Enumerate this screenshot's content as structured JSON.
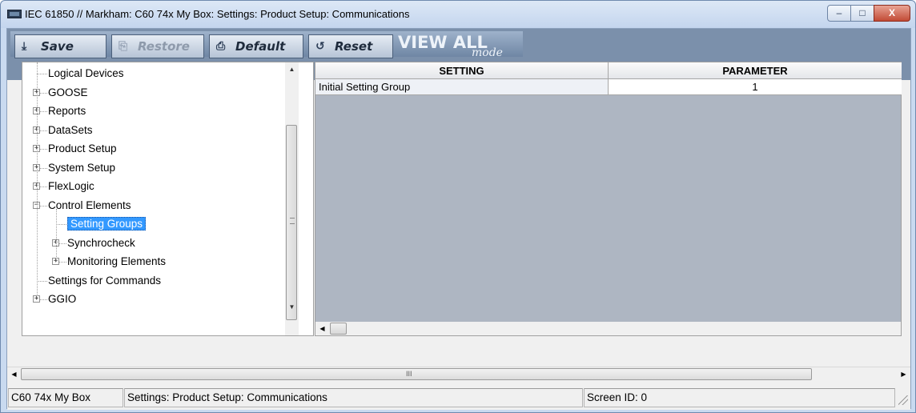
{
  "window": {
    "title": "IEC 61850 // Markham: C60 74x My Box: Settings: Product Setup: Communications",
    "controls": {
      "minimize": "–",
      "maximize": "□",
      "close": "X"
    }
  },
  "toolbar": {
    "save_label": "Save",
    "restore_label": "Restore",
    "default_label": "Default",
    "reset_label": "Reset",
    "viewall_label": "VIEW ALL",
    "viewall_mode": "mode",
    "icons": {
      "save": "save-icon",
      "restore": "restore-icon",
      "default": "default-icon",
      "reset": "reset-icon"
    }
  },
  "tree": {
    "items": [
      {
        "label": "Logical Devices",
        "expander": ""
      },
      {
        "label": "GOOSE",
        "expander": "+"
      },
      {
        "label": "Reports",
        "expander": "+"
      },
      {
        "label": "DataSets",
        "expander": "+"
      },
      {
        "label": "Product Setup",
        "expander": "+"
      },
      {
        "label": "System Setup",
        "expander": "+"
      },
      {
        "label": "FlexLogic",
        "expander": "+"
      },
      {
        "label": "Control Elements",
        "expander": "−"
      },
      {
        "label": "Setting Groups",
        "expander": "",
        "selected": true
      },
      {
        "label": "Synchrocheck",
        "expander": "+"
      },
      {
        "label": "Monitoring Elements",
        "expander": "+"
      },
      {
        "label": "Settings for Commands",
        "expander": ""
      },
      {
        "label": "GGIO",
        "expander": "+"
      }
    ]
  },
  "grid": {
    "columns": [
      "SETTING",
      "PARAMETER"
    ],
    "rows": [
      {
        "setting": "Initial Setting Group",
        "parameter": "1"
      }
    ]
  },
  "statusbar": {
    "device": "C60 74x My Box",
    "path": "Settings: Product Setup: Communications",
    "screen_id": "Screen ID: 0"
  },
  "scrollbar": {
    "grip": "III"
  }
}
